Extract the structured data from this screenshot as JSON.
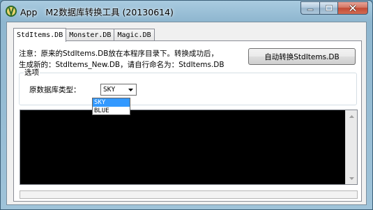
{
  "window": {
    "title": "M2数据库转换工具 (20130614)",
    "app_label": "App"
  },
  "tabs": [
    {
      "label": "StdItems.DB",
      "active": true
    },
    {
      "label": "Monster.DB",
      "active": false
    },
    {
      "label": "Magic.DB",
      "active": false
    }
  ],
  "notice": {
    "line1": "注意：原来的StdItems.DB放在本程序目录下。转换成功后，",
    "line2": "生成新的：StdItems_New.DB，请自行命名为：StdItems.DB"
  },
  "buttons": {
    "auto_convert": "自动转换StdItems.DB"
  },
  "options": {
    "group_label": "选项",
    "db_type_label": "原数据库类型：",
    "db_type_value": "SKY",
    "db_type_options": [
      "SKY",
      "BLUE"
    ],
    "highlighted_option": "SKY"
  },
  "colors": {
    "log_background": "#000000",
    "selection": "#3399ff",
    "close_button": "#c24b34"
  }
}
